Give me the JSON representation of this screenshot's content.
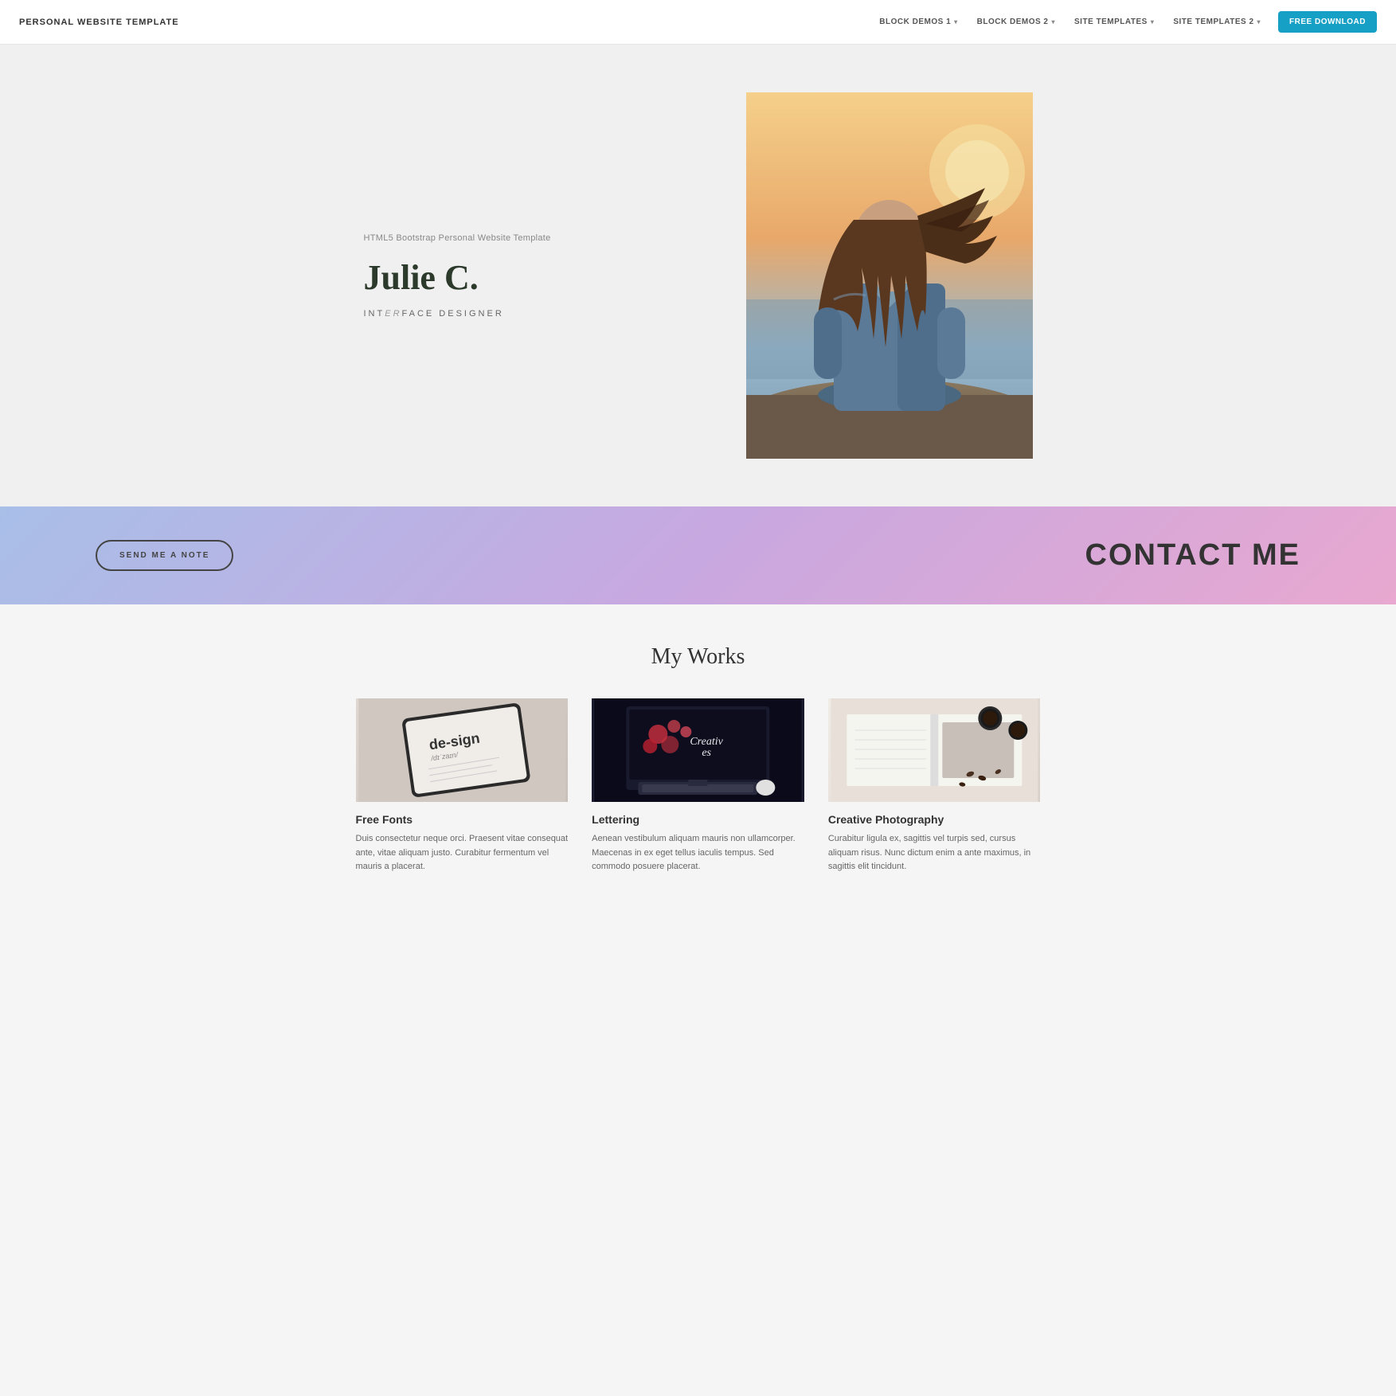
{
  "navbar": {
    "brand": "PERSONAL WEBSITE TEMPLATE",
    "links": [
      {
        "label": "BLOCK DEMOS 1",
        "hasDropdown": true
      },
      {
        "label": "BLOCK DEMOS 2",
        "hasDropdown": true
      },
      {
        "label": "SITE TEMPLATES",
        "hasDropdown": true
      },
      {
        "label": "SITE TEMPLATES 2",
        "hasDropdown": true
      }
    ],
    "cta": "FREE DOWNLOAD"
  },
  "hero": {
    "subtitle": "HTML5 Bootstrap Personal Website Template",
    "name": "Julie C.",
    "role_prefix": "INT",
    "role_italic": "er",
    "role_suffix": "FACE DESIGNER"
  },
  "contact": {
    "button": "SEND ME A NOTE",
    "title": "CONTACT ME"
  },
  "works": {
    "section_title": "My Works",
    "items": [
      {
        "title": "Free Fonts",
        "description": "Duis consectetur neque orci. Praesent vitae consequat ante, vitae aliquam justo. Curabitur fermentum vel mauris a placerat."
      },
      {
        "title": "Lettering",
        "description": "Aenean vestibulum aliquam mauris non ullamcorper. Maecenas in ex eget tellus iaculis tempus. Sed commodo posuere placerat."
      },
      {
        "title": "Creative Photography",
        "description": "Curabitur ligula ex, sagittis vel turpis sed, cursus aliquam risus. Nunc dictum enim a ante maximus, in sagittis elit tincidunt."
      }
    ]
  }
}
